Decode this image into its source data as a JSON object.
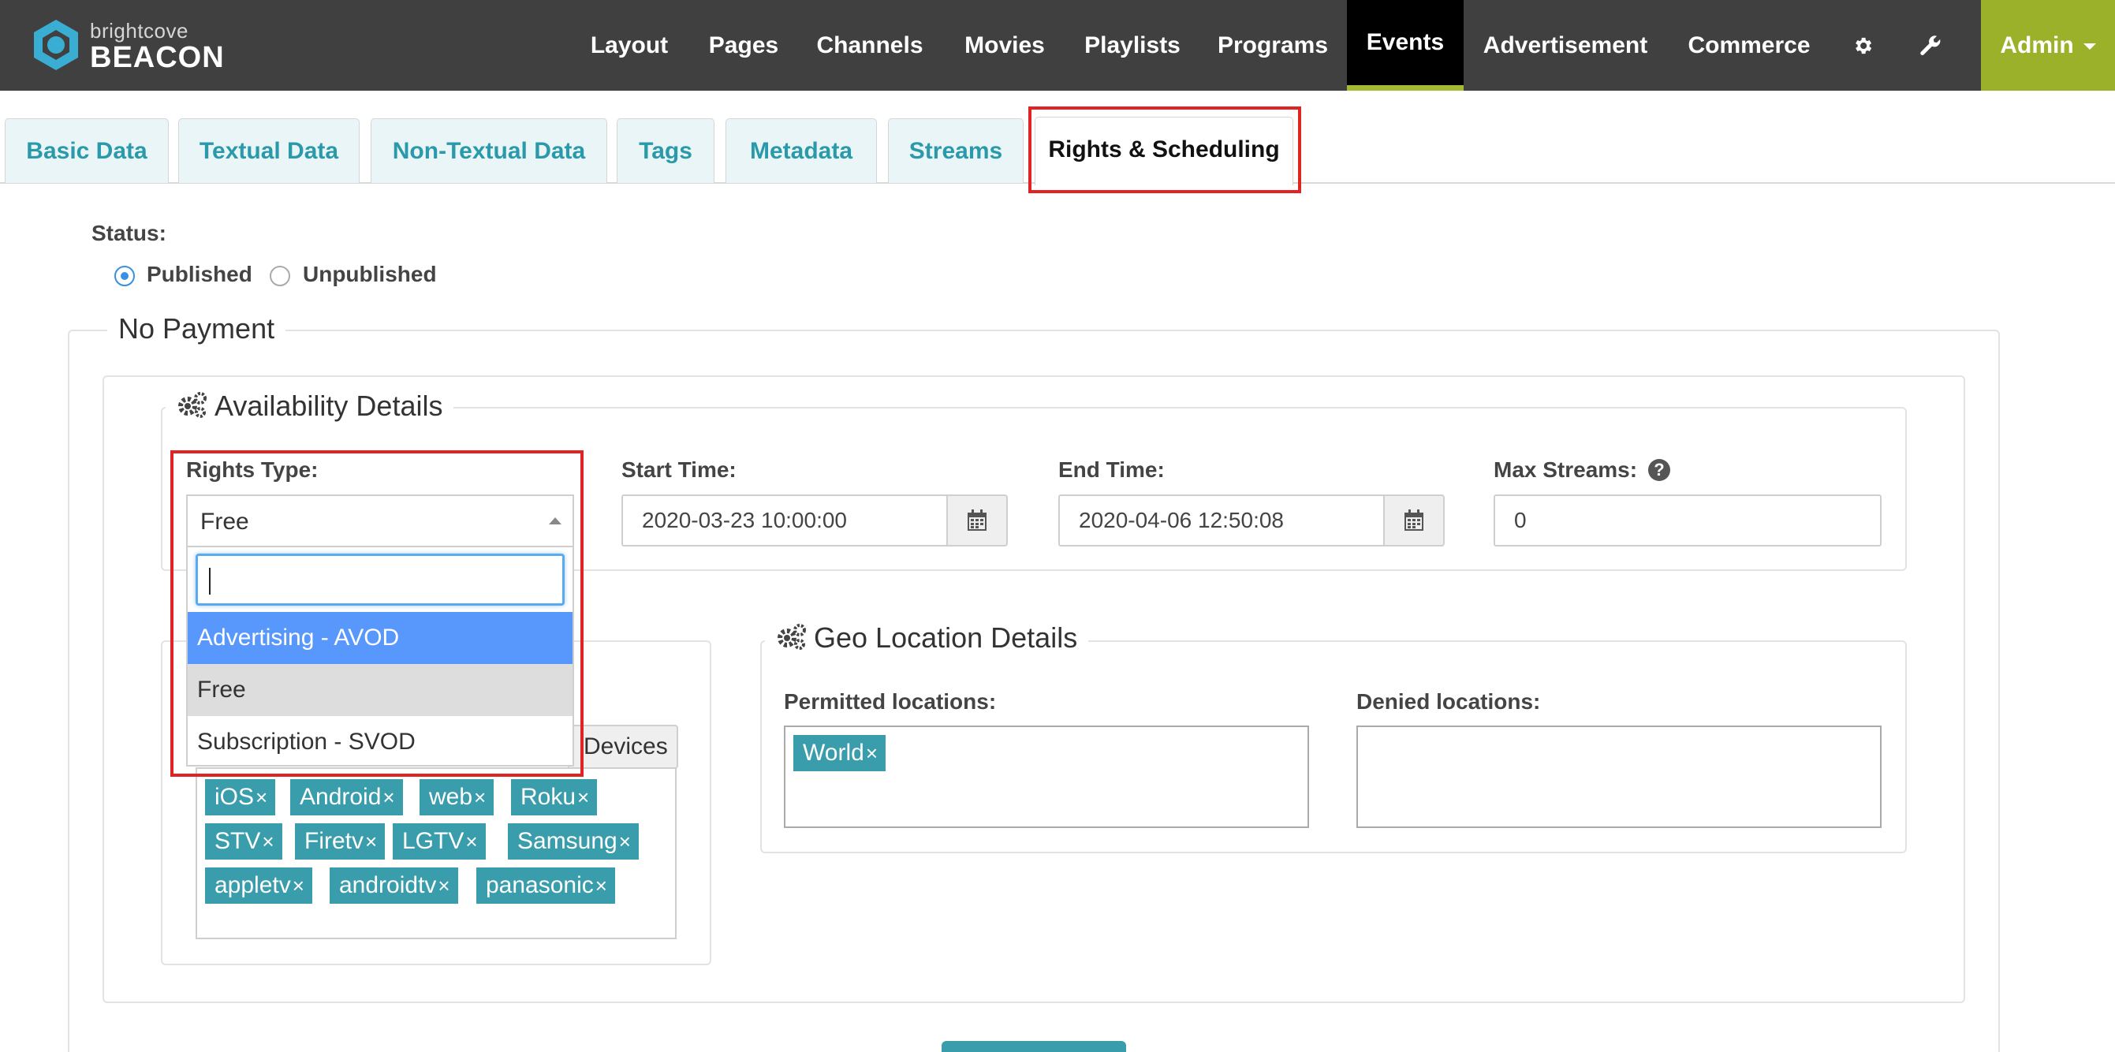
{
  "navbar": {
    "logo_small": "brightcove",
    "logo_big": "BEACON",
    "items": [
      {
        "label": "Layout"
      },
      {
        "label": "Pages"
      },
      {
        "label": "Channels"
      },
      {
        "label": "Movies"
      },
      {
        "label": "Playlists"
      },
      {
        "label": "Programs"
      },
      {
        "label": "Events"
      },
      {
        "label": "Advertisement"
      },
      {
        "label": "Commerce"
      }
    ],
    "active_item": "Events",
    "icons": [
      "gear-icon",
      "wrench-icon"
    ],
    "admin_label": "Admin"
  },
  "tabs": [
    {
      "label": "Basic Data"
    },
    {
      "label": "Textual Data"
    },
    {
      "label": "Non-Textual Data"
    },
    {
      "label": "Tags"
    },
    {
      "label": "Metadata"
    },
    {
      "label": "Streams"
    },
    {
      "label": "Rights & Scheduling"
    }
  ],
  "active_tab": "Rights & Scheduling",
  "status": {
    "label": "Status:",
    "options": [
      "Published",
      "Unpublished"
    ],
    "selected": "Published"
  },
  "payment": {
    "legend": "No Payment"
  },
  "availability": {
    "legend": "Availability Details",
    "rights_type": {
      "label": "Rights Type:",
      "value": "Free",
      "search_value": "",
      "options": [
        "Advertising - AVOD",
        "Free",
        "Subscription - SVOD"
      ],
      "highlighted": "Advertising - AVOD"
    },
    "start_time": {
      "label": "Start Time:",
      "value": "2020-03-23 10:00:00"
    },
    "end_time": {
      "label": "End Time:",
      "value": "2020-04-06 12:50:08"
    },
    "max_streams": {
      "label": "Max Streams:",
      "value": "0"
    }
  },
  "devices": {
    "label": "Devices",
    "tags": [
      "iOS",
      "Android",
      "web",
      "Roku",
      "STV",
      "Firetv",
      "LGTV",
      "Samsung",
      "appletv",
      "androidtv",
      "panasonic"
    ]
  },
  "geo": {
    "legend": "Geo Location Details",
    "permitted_label": "Permitted locations:",
    "permitted": [
      "World"
    ],
    "denied_label": "Denied locations:",
    "denied": []
  },
  "colors": {
    "navbar_bg": "#404040",
    "active_accent": "#a4b934",
    "admin_bg": "#9bb12a",
    "tab_text": "#2a9aaa",
    "tag_bg": "#3a9dab",
    "highlight_option": "#5897fb",
    "annotation_red": "#e02424"
  }
}
